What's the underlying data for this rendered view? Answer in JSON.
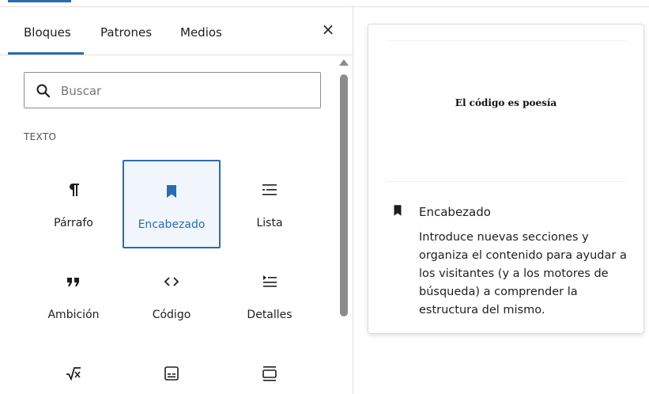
{
  "tabs": [
    {
      "label": "Bloques",
      "active": true
    },
    {
      "label": "Patrones",
      "active": false
    },
    {
      "label": "Medios",
      "active": false
    }
  ],
  "close_glyph": "×",
  "search": {
    "placeholder": "Buscar",
    "value": ""
  },
  "category": "TEXTO",
  "blocks": [
    {
      "label": "Párrafo",
      "icon": "paragraph-icon",
      "selected": false
    },
    {
      "label": "Encabezado",
      "icon": "bookmark-icon",
      "selected": true
    },
    {
      "label": "Lista",
      "icon": "list-icon",
      "selected": false
    },
    {
      "label": "Ambición",
      "icon": "quote-icon",
      "selected": false
    },
    {
      "label": "Código",
      "icon": "code-icon",
      "selected": false
    },
    {
      "label": "Detalles",
      "icon": "details-icon",
      "selected": false
    },
    {
      "label": "",
      "icon": "math-icon",
      "selected": false
    },
    {
      "label": "",
      "icon": "preformatted-icon",
      "selected": false
    },
    {
      "label": "",
      "icon": "pullquote-icon",
      "selected": false
    }
  ],
  "preview": {
    "sample_heading": "El código es poesía",
    "title": "Encabezado",
    "description": "Introduce nuevas secciones y organiza el contenido para ayudar a los visitantes (y a los motores de búsqueda) a comprender la estructura del mismo."
  },
  "colors": {
    "accent": "#2b6cb0",
    "selected_bg": "#f0f6fb"
  }
}
